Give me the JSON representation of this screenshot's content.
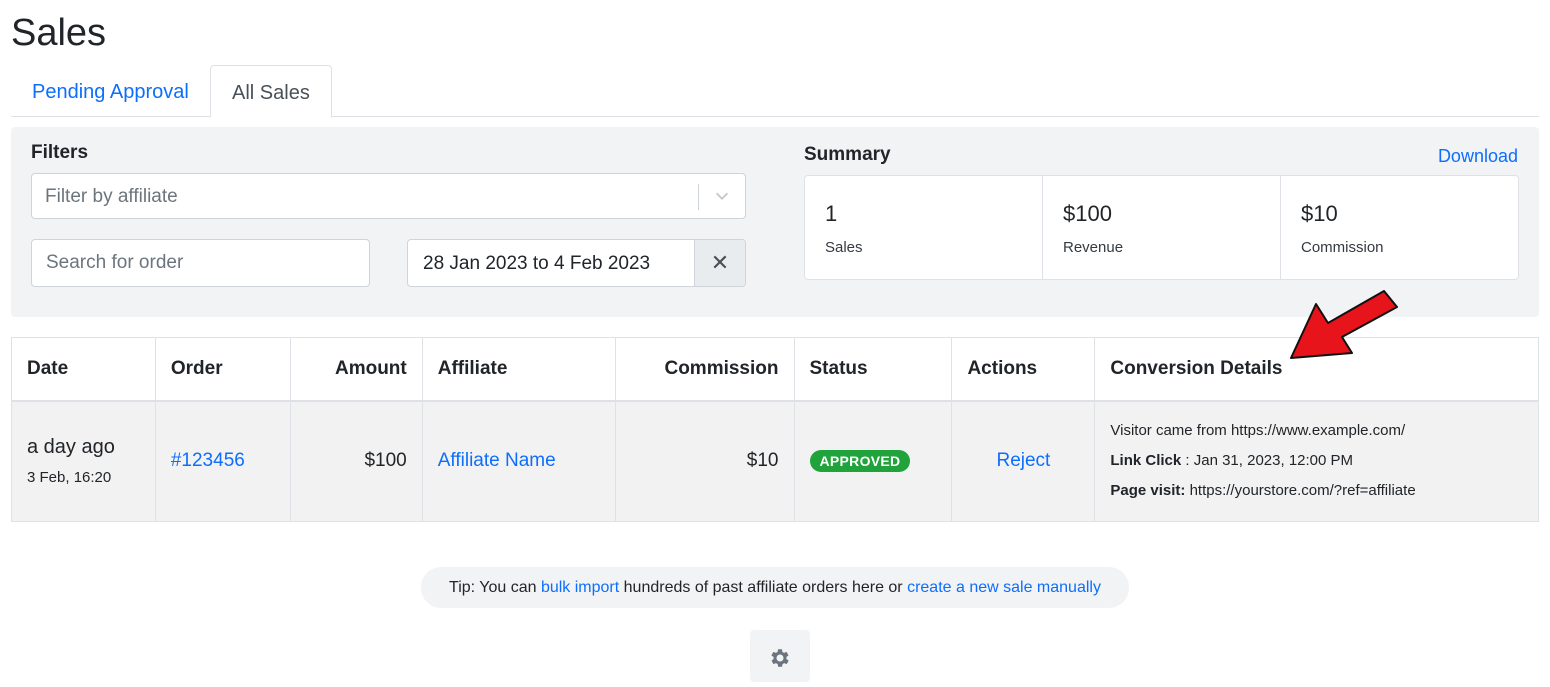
{
  "page": {
    "title": "Sales"
  },
  "tabs": [
    {
      "label": "Pending Approval",
      "active": false
    },
    {
      "label": "All Sales",
      "active": true
    }
  ],
  "filters": {
    "title": "Filters",
    "affiliate_placeholder": "Filter by affiliate",
    "order_search_placeholder": "Search for order",
    "date_range": "28 Jan 2023 to 4 Feb 2023",
    "clear_symbol": "✕"
  },
  "summary": {
    "title": "Summary",
    "download_label": "Download",
    "cards": [
      {
        "value": "1",
        "label": "Sales"
      },
      {
        "value": "$100",
        "label": "Revenue"
      },
      {
        "value": "$10",
        "label": "Commission"
      }
    ]
  },
  "table": {
    "headers": {
      "date": "Date",
      "order": "Order",
      "amount": "Amount",
      "affiliate": "Affiliate",
      "commission": "Commission",
      "status": "Status",
      "actions": "Actions",
      "conversion": "Conversion Details"
    },
    "rows": [
      {
        "date_relative": "a day ago",
        "date_exact": "3 Feb, 16:20",
        "order": "#123456",
        "amount": "$100",
        "affiliate": "Affiliate Name",
        "commission": "$10",
        "status": "APPROVED",
        "action": "Reject",
        "conversion": {
          "visitor_text": "Visitor came from https://www.example.com/",
          "link_click_label": "Link Click",
          "link_click_value": " : Jan 31, 2023, 12:00 PM",
          "page_visit_label": "Page visit:",
          "page_visit_value": " https://yourstore.com/?ref=affiliate"
        }
      }
    ]
  },
  "tip": {
    "prefix": "Tip: You can ",
    "bulk_import_link": "bulk import",
    "middle": " hundreds of past affiliate orders here or ",
    "create_link": "create a new sale manually"
  },
  "icons": {
    "chevron": "chevron-down-icon",
    "gear": "gear-icon",
    "arrow": "red-arrow-icon"
  },
  "colors": {
    "link": "#0d6efd",
    "approved_badge": "#1fa33a",
    "panel_bg": "#f2f3f5",
    "arrow": "#e8141c"
  }
}
